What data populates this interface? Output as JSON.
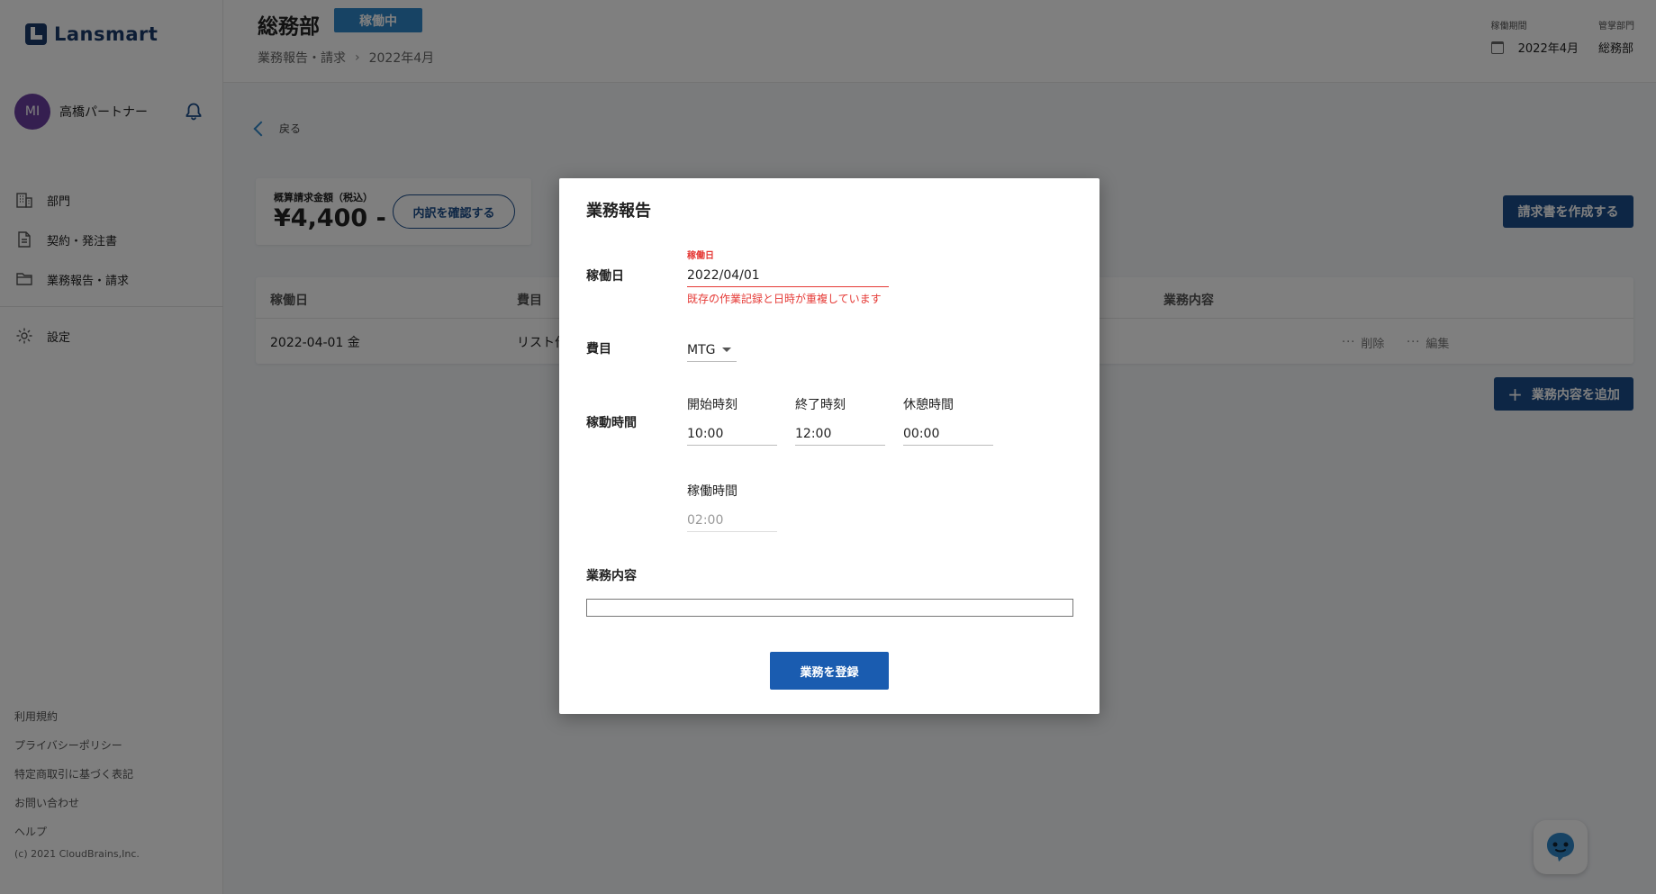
{
  "app": {
    "logo_text": "Lansmart"
  },
  "user": {
    "initials": "MI",
    "name": "高橋パートナー"
  },
  "sidebar": {
    "items": [
      {
        "label": "部門",
        "icon": "building-icon"
      },
      {
        "label": "契約・発注書",
        "icon": "document-icon"
      },
      {
        "label": "業務報告・請求",
        "icon": "folder-icon"
      },
      {
        "label": "設定",
        "icon": "gear-icon"
      }
    ],
    "footer_links": [
      "利用規約",
      "プライバシーポリシー",
      "特定商取引に基づく表記",
      "お問い合わせ",
      "ヘルプ"
    ],
    "copyright": "(c) 2021 CloudBrains,Inc."
  },
  "header": {
    "title": "総務部",
    "status": "稼働中",
    "breadcrumb": [
      "業務報告・請求",
      "2022年4月"
    ],
    "period_label": "稼働期間",
    "period_value": "2022年4月",
    "dept_label": "管掌部門",
    "dept_value": "総務部"
  },
  "main": {
    "back_label": "戻る",
    "total_label": "概算請求金額（税込）",
    "total_amount": "¥4,400 -",
    "breakdown_button": "内訳を確認する",
    "invoice_button": "請求書を作成する",
    "add_button": "業務内容を追加",
    "table": {
      "headers": [
        "稼働日",
        "費目",
        "業務内容"
      ],
      "rows": [
        {
          "date": "2022-04-01 金",
          "category": "リスト作",
          "delete": "削除",
          "edit": "編集"
        }
      ]
    }
  },
  "modal": {
    "title": "業務報告",
    "date_label": "稼働日",
    "date_float_label": "稼働日",
    "date_value": "2022/04/01",
    "date_error": "既存の作業記録と日時が重複しています",
    "category_label": "費目",
    "category_value": "MTG",
    "time_label": "稼動時間",
    "start_label": "開始時刻",
    "start_value": "10:00",
    "end_label": "終了時刻",
    "end_value": "12:00",
    "break_label": "休憩時間",
    "break_value": "00:00",
    "worked_label": "稼働時間",
    "worked_value": "02:00",
    "content_label": "業務内容",
    "content_value": "",
    "submit_button": "業務を登録"
  },
  "colors": {
    "primary": "#1a4c8a",
    "badge": "#2e86c9",
    "error": "#e53935",
    "avatar": "#6a3fa0"
  }
}
